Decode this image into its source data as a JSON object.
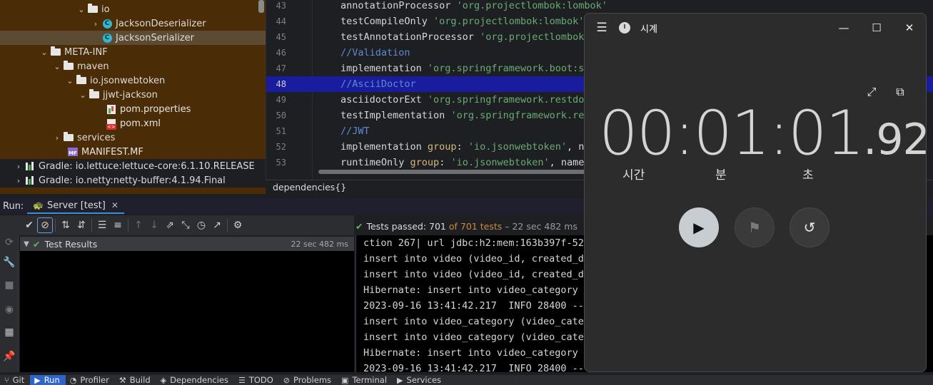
{
  "project_tree": {
    "items": [
      {
        "label": "io",
        "kind": "folder",
        "expanded": true
      },
      {
        "label": "JacksonDeserializer",
        "kind": "class",
        "expanded": false
      },
      {
        "label": "JacksonSerializer",
        "kind": "class",
        "selected": true
      },
      {
        "label": "META-INF",
        "kind": "folder",
        "expanded": true
      },
      {
        "label": "maven",
        "kind": "folder",
        "expanded": true
      },
      {
        "label": "io.jsonwebtoken",
        "kind": "folder",
        "expanded": true
      },
      {
        "label": "jjwt-jackson",
        "kind": "folder",
        "expanded": true
      },
      {
        "label": "pom.properties",
        "kind": "properties-file"
      },
      {
        "label": "pom.xml",
        "kind": "xml-file"
      },
      {
        "label": "services",
        "kind": "folder",
        "expanded": false
      },
      {
        "label": "MANIFEST.MF",
        "kind": "manifest-file"
      },
      {
        "label": "Gradle: io.lettuce:lettuce-core:6.1.10.RELEASE",
        "kind": "library"
      },
      {
        "label": "Gradle: io.netty:netty-buffer:4.1.94.Final",
        "kind": "library"
      }
    ]
  },
  "editor": {
    "lines": [
      {
        "n": "43",
        "parts": [
          [
            "id",
            "annotationProcessor "
          ],
          [
            "str",
            "'org.projectlombok:lombok'"
          ]
        ]
      },
      {
        "n": "44",
        "parts": [
          [
            "id",
            "testCompileOnly "
          ],
          [
            "str",
            "'org.projectlombok:lombok'"
          ]
        ]
      },
      {
        "n": "45",
        "parts": [
          [
            "id",
            "testAnnotationProcessor "
          ],
          [
            "str",
            "'org.projectlombok:"
          ]
        ]
      },
      {
        "n": "46",
        "parts": [
          [
            "cmt",
            "//Validation"
          ]
        ]
      },
      {
        "n": "47",
        "parts": [
          [
            "id",
            "implementation "
          ],
          [
            "str",
            "'org.springframework.boot:sp"
          ]
        ]
      },
      {
        "n": "48",
        "parts": [
          [
            "cmt",
            "//AsciiDoctor"
          ]
        ],
        "current": true
      },
      {
        "n": "49",
        "parts": [
          [
            "id",
            "asciidoctorExt "
          ],
          [
            "str",
            "'org.springframework.restdoc"
          ]
        ]
      },
      {
        "n": "50",
        "parts": [
          [
            "id",
            "testImplementation "
          ],
          [
            "str",
            "'org.springframework.res"
          ]
        ]
      },
      {
        "n": "51",
        "parts": [
          [
            "cmt",
            "//JWT"
          ]
        ]
      },
      {
        "n": "52",
        "parts": [
          [
            "id",
            "implementation "
          ],
          [
            "kw",
            "group"
          ],
          [
            "id",
            ": "
          ],
          [
            "str",
            "'io.jsonwebtoken'"
          ],
          [
            "id",
            ", na"
          ]
        ]
      },
      {
        "n": "53",
        "parts": [
          [
            "id",
            "runtimeOnly "
          ],
          [
            "kw",
            "group"
          ],
          [
            "id",
            ": "
          ],
          [
            "str",
            "'io.jsonwebtoken'"
          ],
          [
            "id",
            ", name:"
          ]
        ]
      }
    ],
    "breadcrumb": "dependencies{}"
  },
  "run_window": {
    "label": "Run:",
    "tab_label": "Server [test]",
    "results_label": "Test Results",
    "results_time": "22 sec 482 ms",
    "status_passed": "Tests passed: 701",
    "status_of": "of 701 tests",
    "status_duration": "– 22 sec 482 ms",
    "console_lines": [
      "ction 267| url jdbc:h2:mem:163b397f-52a",
      "insert into video (video_id, created_da",
      "insert into video (video_id, created_da",
      "Hibernate: insert into video_category (",
      "2023-09-16 13:41:42.217  INFO 28400 ---",
      "insert into video_category (video_categ",
      "insert into video_category (video_categ",
      "Hibernate: insert into video_category (",
      "2023-09-16 13:41:42.217  INFO 28400 ---"
    ]
  },
  "bottom_bar": {
    "items": [
      {
        "label": "Git",
        "icon": "git-branch-icon"
      },
      {
        "label": "Run",
        "icon": "run-icon",
        "active": true
      },
      {
        "label": "Profiler",
        "icon": "profiler-icon"
      },
      {
        "label": "Build",
        "icon": "hammer-icon"
      },
      {
        "label": "Dependencies",
        "icon": "layers-icon"
      },
      {
        "label": "TODO",
        "icon": "list-icon"
      },
      {
        "label": "Problems",
        "icon": "problems-icon"
      },
      {
        "label": "Terminal",
        "icon": "terminal-icon"
      },
      {
        "label": "Services",
        "icon": "services-icon"
      }
    ]
  },
  "clock": {
    "app_name": "시계",
    "time_main": "00:01:01",
    "time_fraction": ".92",
    "units": {
      "hours": "시간",
      "minutes": "분",
      "seconds": "초"
    },
    "colors": {
      "background": "#2c2c2c",
      "play_button": "#c7cdd1"
    }
  },
  "colors": {
    "tree_background": "#4a2c06",
    "current_line": "#1a1ca0",
    "string": "#6aab73",
    "comment": "#5f8ad1",
    "passed": "#5fb55f",
    "run_tab_active": "#2f65c8"
  }
}
